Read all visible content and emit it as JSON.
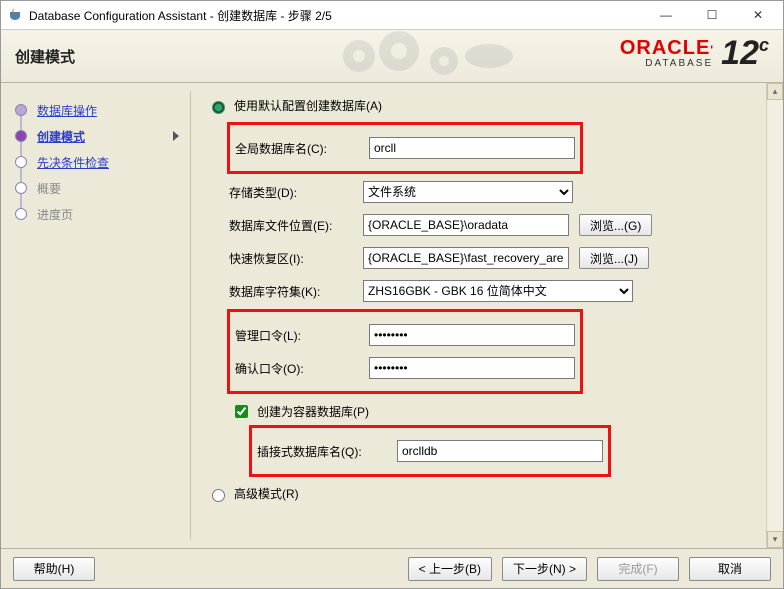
{
  "window": {
    "title": "Database Configuration Assistant - 创建数据库 - 步骤 2/5",
    "min": "—",
    "max": "☐",
    "close": "✕"
  },
  "header": {
    "title": "创建模式",
    "brand_top": "ORACLE",
    "brand_sub": "DATABASE",
    "brand_ver": "12",
    "brand_c": "c"
  },
  "steps": {
    "items": [
      {
        "label": "数据库操作",
        "state": "done",
        "link": true
      },
      {
        "label": "创建模式",
        "state": "current",
        "link": true
      },
      {
        "label": "先决条件检查",
        "state": "pending",
        "link": true
      },
      {
        "label": "概要",
        "state": "disabled",
        "link": false
      },
      {
        "label": "进度页",
        "state": "disabled",
        "link": false
      }
    ]
  },
  "form": {
    "mode_default": "使用默认配置创建数据库(A)",
    "mode_advanced": "高级模式(R)",
    "global_db_label": "全局数据库名(C):",
    "global_db_value": "orcll",
    "storage_label": "存储类型(D):",
    "storage_value": "文件系统",
    "file_loc_label": "数据库文件位置(E):",
    "file_loc_value": "{ORACLE_BASE}\\oradata",
    "browse1": "浏览...(G)",
    "fra_label": "快速恢复区(I):",
    "fra_value": "{ORACLE_BASE}\\fast_recovery_area",
    "browse2": "浏览...(J)",
    "charset_label": "数据库字符集(K):",
    "charset_value": "ZHS16GBK - GBK 16 位简体中文",
    "admin_pw_label": "管理口令(L):",
    "admin_pw_value": "••••••••",
    "confirm_pw_label": "确认口令(O):",
    "confirm_pw_value": "••••••••",
    "create_cdb_label": "创建为容器数据库(P)",
    "pdb_label": "插接式数据库名(Q):",
    "pdb_value": "orclldb"
  },
  "footer": {
    "help": "帮助(H)",
    "back": "< 上一步(B)",
    "next": "下一步(N) >",
    "finish": "完成(F)",
    "cancel": "取消"
  }
}
